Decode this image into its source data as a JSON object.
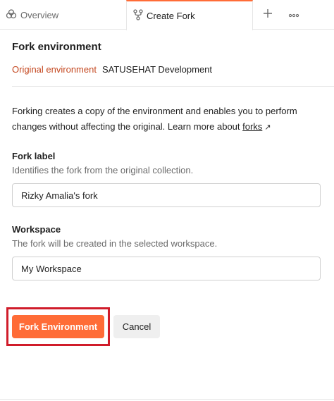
{
  "tabs": {
    "overview_label": "Overview",
    "create_fork_label": "Create Fork"
  },
  "header": {
    "title": "Fork environment",
    "original_label": "Original environment",
    "original_value": "SATUSEHAT Development"
  },
  "description": {
    "text": "Forking creates a copy of the environment and enables you to perform changes without affecting the original. Learn more about ",
    "link": "forks",
    "link_arrow": "↗"
  },
  "fork_label": {
    "label": "Fork label",
    "help": "Identifies the fork from the original collection.",
    "value": "Rizky Amalia's fork"
  },
  "workspace": {
    "label": "Workspace",
    "help": "The fork will be created in the selected workspace.",
    "value": "My Workspace"
  },
  "actions": {
    "primary_label": "Fork Environment",
    "cancel_label": "Cancel"
  },
  "colors": {
    "accent": "#ff6c37",
    "original_label": "#c4471f",
    "highlight_box": "#d01c2a"
  }
}
